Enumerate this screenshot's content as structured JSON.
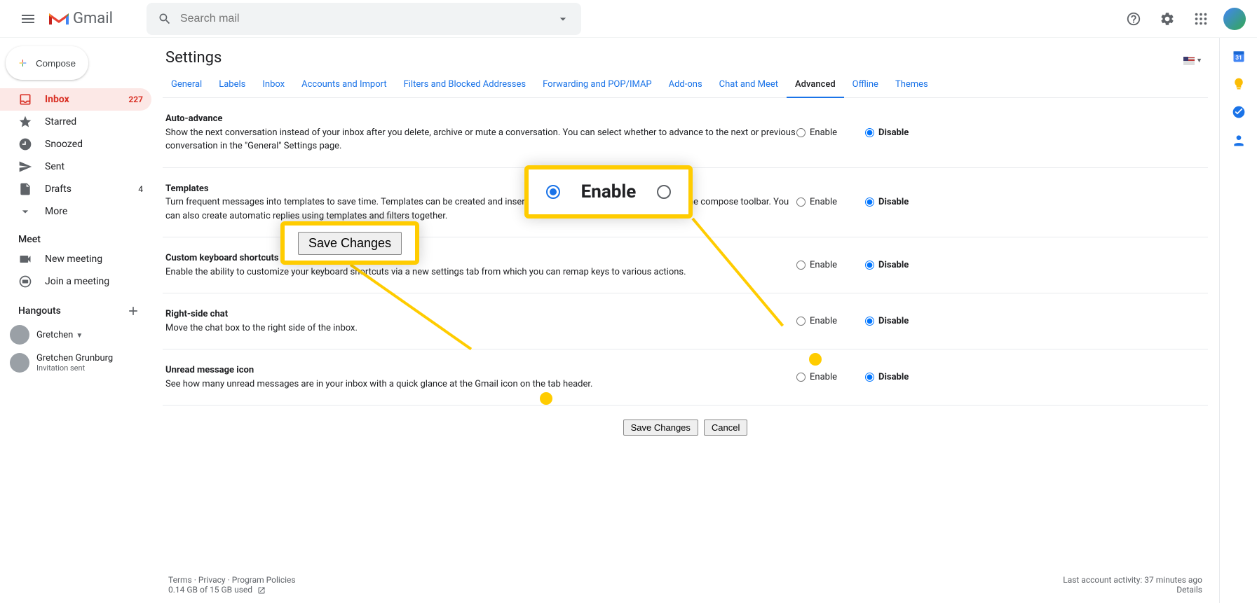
{
  "header": {
    "logo_text": "Gmail",
    "search_placeholder": "Search mail"
  },
  "compose_label": "Compose",
  "sidebar": {
    "items": [
      {
        "label": "Inbox",
        "count": "227",
        "active": true
      },
      {
        "label": "Starred"
      },
      {
        "label": "Snoozed"
      },
      {
        "label": "Sent"
      },
      {
        "label": "Drafts",
        "count": "4"
      },
      {
        "label": "More"
      }
    ],
    "meet_header": "Meet",
    "meet_items": [
      {
        "label": "New meeting"
      },
      {
        "label": "Join a meeting"
      }
    ],
    "hangouts_header": "Hangouts",
    "hangouts": [
      {
        "name": "Gretchen"
      },
      {
        "name": "Gretchen Grunburg",
        "sub": "Invitation sent"
      }
    ]
  },
  "settings": {
    "title": "Settings",
    "tabs": [
      "General",
      "Labels",
      "Inbox",
      "Accounts and Import",
      "Filters and Blocked Addresses",
      "Forwarding and POP/IMAP",
      "Add-ons",
      "Chat and Meet",
      "Advanced",
      "Offline",
      "Themes"
    ],
    "active_tab": "Advanced",
    "rows": [
      {
        "title": "Auto-advance",
        "desc": "Show the next conversation instead of your inbox after you delete, archive or mute a conversation. You can select whether to advance to the next or previous conversation in the \"General\" Settings page.",
        "enable": "Enable",
        "disable": "Disable",
        "selected": "disable"
      },
      {
        "title": "Templates",
        "desc": "Turn frequent messages into templates to save time. Templates can be created and inserted through the \"More options\" menu in the compose toolbar. You can also create automatic replies using templates and filters together.",
        "enable": "Enable",
        "disable": "Disable",
        "selected": "disable"
      },
      {
        "title": "Custom keyboard shortcuts",
        "desc": "Enable the ability to customize your keyboard shortcuts via a new settings tab from which you can remap keys to various actions.",
        "enable": "Enable",
        "disable": "Disable",
        "selected": "disable"
      },
      {
        "title": "Right-side chat",
        "desc": "Move the chat box to the right side of the inbox.",
        "enable": "Enable",
        "disable": "Disable",
        "selected": "disable"
      },
      {
        "title": "Unread message icon",
        "desc": "See how many unread messages are in your inbox with a quick glance at the Gmail icon on the tab header.",
        "enable": "Enable",
        "disable": "Disable",
        "selected": "disable"
      }
    ],
    "save_label": "Save Changes",
    "cancel_label": "Cancel"
  },
  "callouts": {
    "enable_text": "Enable",
    "save_text": "Save Changes"
  },
  "footer": {
    "terms": "Terms",
    "privacy": "Privacy",
    "policies": "Program Policies",
    "storage": "0.14 GB of 15 GB used",
    "activity": "Last account activity: 37 minutes ago",
    "details": "Details"
  }
}
